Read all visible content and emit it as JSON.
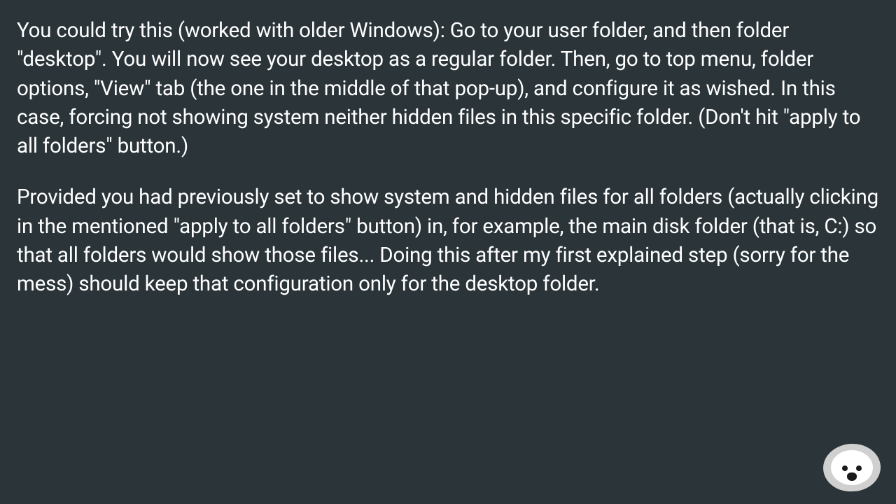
{
  "content": {
    "paragraphs": [
      "You could try this (worked with older Windows): Go to your user folder, and then folder \"desktop\". You will now see your desktop as a regular folder. Then, go to top menu, folder options, \"View\" tab (the one in the middle of that pop-up), and configure it as wished. In this case, forcing not showing system neither hidden files in this specific folder. (Don't hit \"apply to all folders\" button.)",
      "Provided you had previously set to show system and hidden files for all folders (actually clicking in the mentioned \"apply to all folders\" button) in, for example, the main disk folder (that is, C:) so that all folders would show those files... Doing this after my first explained step (sorry for the mess) should keep that configuration only for the desktop folder."
    ]
  },
  "avatar": {
    "name": "seal-avatar"
  }
}
